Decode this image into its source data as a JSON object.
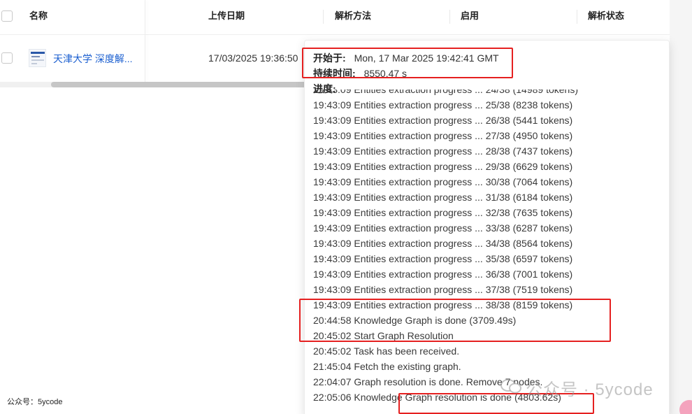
{
  "table": {
    "headers": {
      "name": "名称",
      "upload_date": "上传日期",
      "parse_method": "解析方法",
      "enabled": "启用",
      "parse_status": "解析状态"
    },
    "row": {
      "doc_name": "天津大学 深度解...",
      "upload_date": "17/03/2025 19:36:50"
    }
  },
  "popover": {
    "start_label": "开始于:",
    "start_value": "Mon, 17 Mar 2025 19:42:41 GMT",
    "duration_label": "持续时间:",
    "duration_value": "8550.47 s",
    "progress_label": "进度:",
    "logs": [
      "19:43:09 Entities extraction progress ... 24/38 (14989 tokens)",
      "19:43:09 Entities extraction progress ... 25/38 (8238 tokens)",
      "19:43:09 Entities extraction progress ... 26/38 (5441 tokens)",
      "19:43:09 Entities extraction progress ... 27/38 (4950 tokens)",
      "19:43:09 Entities extraction progress ... 28/38 (7437 tokens)",
      "19:43:09 Entities extraction progress ... 29/38 (6629 tokens)",
      "19:43:09 Entities extraction progress ... 30/38 (7064 tokens)",
      "19:43:09 Entities extraction progress ... 31/38 (6184 tokens)",
      "19:43:09 Entities extraction progress ... 32/38 (7635 tokens)",
      "19:43:09 Entities extraction progress ... 33/38 (6287 tokens)",
      "19:43:09 Entities extraction progress ... 34/38 (8564 tokens)",
      "19:43:09 Entities extraction progress ... 35/38 (6597 tokens)",
      "19:43:09 Entities extraction progress ... 36/38 (7001 tokens)",
      "19:43:09 Entities extraction progress ... 37/38 (7519 tokens)",
      "19:43:09 Entities extraction progress ... 38/38 (8159 tokens)",
      "20:44:58 Knowledge Graph is done (3709.49s)",
      "20:45:02 Start Graph Resolution",
      "20:45:02 Task has been received.",
      "21:45:04 Fetch the existing graph.",
      "22:04:07 Graph resolution is done. Remove 7 nodes.",
      "22:05:06 Knowledge Graph resolution is done (4803.62s)"
    ]
  },
  "footer": {
    "account": "公众号：5ycode"
  },
  "watermark": {
    "text": "公众号 · 5ycode"
  },
  "colors": {
    "link": "#1b5fd0",
    "highlight": "#e52020"
  }
}
